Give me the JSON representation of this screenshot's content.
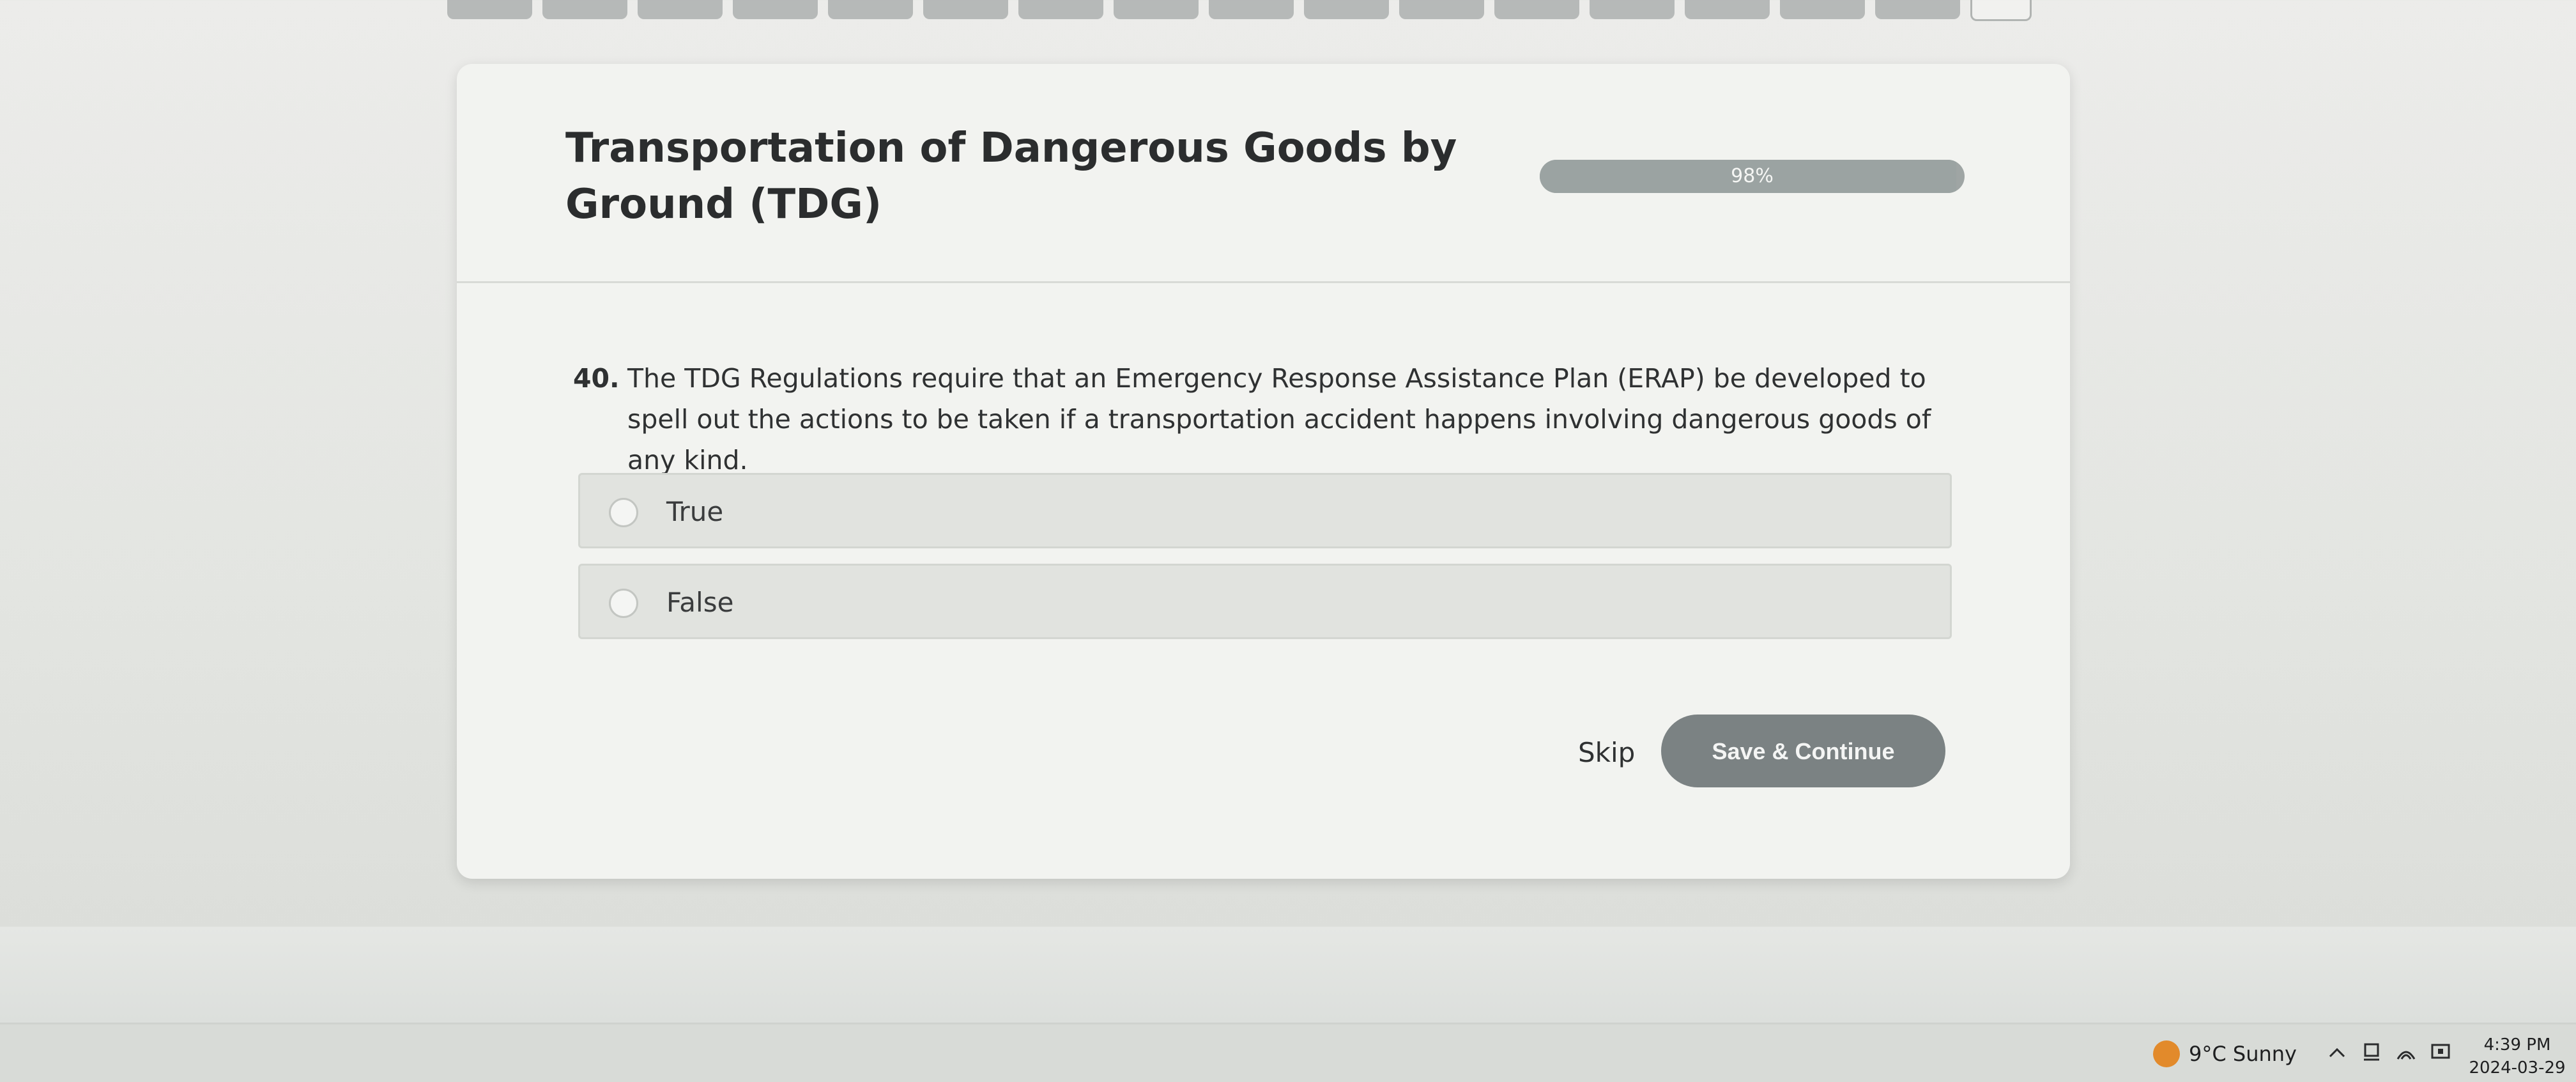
{
  "course": {
    "title": "Transportation of Dangerous Goods by Ground (TDG)"
  },
  "progress": {
    "value_percent": 98,
    "label": "98%"
  },
  "question": {
    "number": "40.",
    "text": "The TDG Regulations require that an Emergency Response Assistance Plan (ERAP) be developed to spell out the actions to be taken if a transportation accident happens involving dangerous goods of any kind."
  },
  "options": [
    {
      "label": "True",
      "selected": false
    },
    {
      "label": "False",
      "selected": false
    }
  ],
  "actions": {
    "skip_label": "Skip",
    "save_label": "Save & Continue"
  },
  "taskbar": {
    "weather": "9°C  Sunny",
    "time": "4:39 PM",
    "date": "2024-03-29"
  },
  "colors": {
    "card": "#f2f3f0",
    "button": "#7b8283",
    "progress": "#9fa5a4",
    "weather_icon": "#e28a2b"
  },
  "icons": {
    "weather": "sun-icon",
    "tray_chevron": "chevron-up-icon",
    "tray_1": "device-icon",
    "tray_2": "wifi-icon",
    "tray_3": "display-icon"
  }
}
